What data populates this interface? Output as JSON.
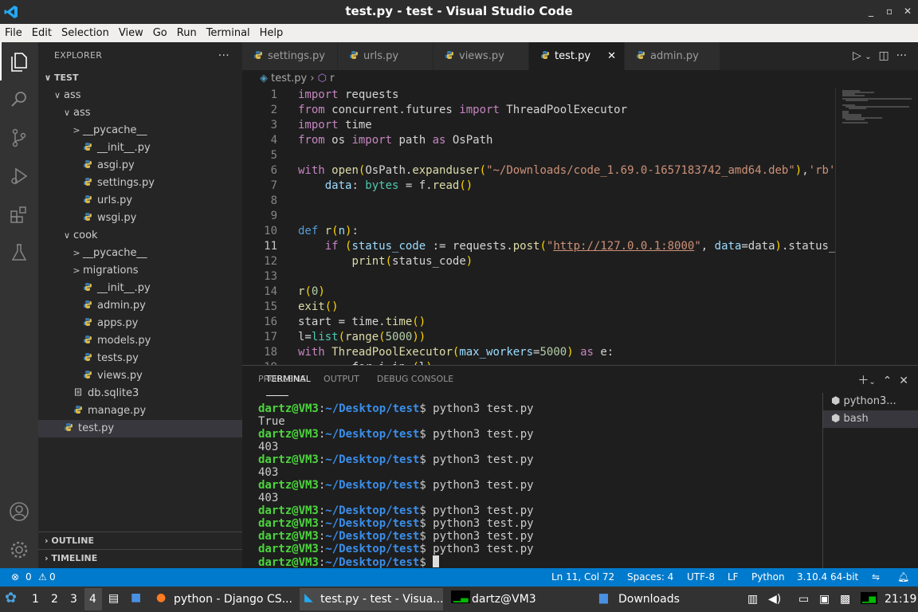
{
  "window": {
    "title": "test.py - test - Visual Studio Code",
    "controls": [
      "_",
      "▫",
      "✕"
    ]
  },
  "menu": [
    "File",
    "Edit",
    "Selection",
    "View",
    "Go",
    "Run",
    "Terminal",
    "Help"
  ],
  "sidebar": {
    "header": "EXPLORER",
    "more": "···",
    "tree": [
      {
        "label": "TEST",
        "indent": 0,
        "type": "root",
        "chev": "∨"
      },
      {
        "label": "ass",
        "indent": 1,
        "type": "folder",
        "chev": "∨"
      },
      {
        "label": "ass",
        "indent": 2,
        "type": "folder",
        "chev": "∨"
      },
      {
        "label": "__pycache__",
        "indent": 3,
        "type": "folder",
        "chev": ">"
      },
      {
        "label": "__init__.py",
        "indent": 3,
        "type": "py"
      },
      {
        "label": "asgi.py",
        "indent": 3,
        "type": "py"
      },
      {
        "label": "settings.py",
        "indent": 3,
        "type": "py"
      },
      {
        "label": "urls.py",
        "indent": 3,
        "type": "py"
      },
      {
        "label": "wsgi.py",
        "indent": 3,
        "type": "py"
      },
      {
        "label": "cook",
        "indent": 2,
        "type": "folder",
        "chev": "∨"
      },
      {
        "label": "__pycache__",
        "indent": 3,
        "type": "folder",
        "chev": ">"
      },
      {
        "label": "migrations",
        "indent": 3,
        "type": "folder",
        "chev": ">"
      },
      {
        "label": "__init__.py",
        "indent": 3,
        "type": "py"
      },
      {
        "label": "admin.py",
        "indent": 3,
        "type": "py"
      },
      {
        "label": "apps.py",
        "indent": 3,
        "type": "py"
      },
      {
        "label": "models.py",
        "indent": 3,
        "type": "py"
      },
      {
        "label": "tests.py",
        "indent": 3,
        "type": "py"
      },
      {
        "label": "views.py",
        "indent": 3,
        "type": "py"
      },
      {
        "label": "db.sqlite3",
        "indent": 2,
        "type": "db"
      },
      {
        "label": "manage.py",
        "indent": 2,
        "type": "py"
      },
      {
        "label": "test.py",
        "indent": 1,
        "type": "py",
        "selected": true
      }
    ],
    "outline": "OUTLINE",
    "timeline": "TIMELINE"
  },
  "tabs": [
    {
      "label": "settings.py",
      "active": false
    },
    {
      "label": "urls.py",
      "active": false
    },
    {
      "label": "views.py",
      "active": false
    },
    {
      "label": "test.py",
      "active": true
    },
    {
      "label": "admin.py",
      "active": false
    }
  ],
  "tab_close": "✕",
  "breadcrumb": {
    "file": "test.py",
    "sep": "›",
    "symbol": "r"
  },
  "editor": {
    "current_line": 11,
    "lines": [
      [
        [
          "k",
          "import"
        ],
        [
          "w",
          " requests"
        ]
      ],
      [
        [
          "k",
          "from"
        ],
        [
          "w",
          " concurrent.futures "
        ],
        [
          "k",
          "import"
        ],
        [
          "w",
          " ThreadPoolExecutor"
        ]
      ],
      [
        [
          "k",
          "import"
        ],
        [
          "w",
          " time"
        ]
      ],
      [
        [
          "k",
          "from"
        ],
        [
          "w",
          " os "
        ],
        [
          "k",
          "import"
        ],
        [
          "w",
          " path "
        ],
        [
          "k",
          "as"
        ],
        [
          "w",
          " OsPath"
        ]
      ],
      [],
      [
        [
          "k",
          "with"
        ],
        [
          "w",
          " "
        ],
        [
          "f",
          "open"
        ],
        [
          "p",
          "("
        ],
        [
          "w",
          "OsPath."
        ],
        [
          "f",
          "expanduser"
        ],
        [
          "p",
          "("
        ],
        [
          "s",
          "\"~/Downloads/code_1.69.0-1657183742_amd64.deb\""
        ],
        [
          "p",
          ")"
        ],
        [
          "w",
          ","
        ],
        [
          "s",
          "'rb'"
        ]
      ],
      [
        [
          "w",
          "    "
        ],
        [
          "v",
          "data"
        ],
        [
          "w",
          ": "
        ],
        [
          "t",
          "bytes"
        ],
        [
          "w",
          " = f."
        ],
        [
          "f",
          "read"
        ],
        [
          "p",
          "()"
        ]
      ],
      [],
      [],
      [
        [
          "kb",
          "def"
        ],
        [
          "w",
          " "
        ],
        [
          "f",
          "r"
        ],
        [
          "p",
          "("
        ],
        [
          "v",
          "n"
        ],
        [
          "p",
          ")"
        ],
        [
          "w",
          ":"
        ]
      ],
      [
        [
          "w",
          "    "
        ],
        [
          "k",
          "if"
        ],
        [
          "w",
          " "
        ],
        [
          "p",
          "("
        ],
        [
          "v",
          "status_code"
        ],
        [
          "w",
          " := requests."
        ],
        [
          "f",
          "post"
        ],
        [
          "p",
          "("
        ],
        [
          "s",
          "\""
        ],
        [
          "u",
          "http://127.0.0.1:8000"
        ],
        [
          "s",
          "\""
        ],
        [
          "w",
          ", "
        ],
        [
          "v",
          "data"
        ],
        [
          "w",
          "=data"
        ],
        [
          "p",
          ")"
        ],
        [
          "w",
          ".status_"
        ]
      ],
      [
        [
          "w",
          "        "
        ],
        [
          "f",
          "print"
        ],
        [
          "p",
          "("
        ],
        [
          "w",
          "status_code"
        ],
        [
          "p",
          ")"
        ]
      ],
      [],
      [
        [
          "f",
          "r"
        ],
        [
          "p",
          "("
        ],
        [
          "n",
          "0"
        ],
        [
          "p",
          ")"
        ]
      ],
      [
        [
          "f",
          "exit"
        ],
        [
          "p",
          "()"
        ]
      ],
      [
        [
          "w",
          "start = time."
        ],
        [
          "f",
          "time"
        ],
        [
          "p",
          "()"
        ]
      ],
      [
        [
          "w",
          "l="
        ],
        [
          "t",
          "list"
        ],
        [
          "p",
          "("
        ],
        [
          "f",
          "range"
        ],
        [
          "p",
          "("
        ],
        [
          "n",
          "5000"
        ],
        [
          "p",
          "))"
        ]
      ],
      [
        [
          "k",
          "with"
        ],
        [
          "w",
          " "
        ],
        [
          "f",
          "ThreadPoolExecutor"
        ],
        [
          "p",
          "("
        ],
        [
          "v",
          "max_workers"
        ],
        [
          "w",
          "="
        ],
        [
          "n",
          "5000"
        ],
        [
          "p",
          ")"
        ],
        [
          "w",
          " "
        ],
        [
          "k",
          "as"
        ],
        [
          "w",
          " e:"
        ]
      ],
      [
        [
          "w",
          "        "
        ],
        [
          "w",
          "for"
        ],
        [
          "w",
          " i "
        ],
        [
          "w",
          "in"
        ],
        [
          "w",
          " "
        ],
        [
          "p",
          "("
        ],
        [
          "w",
          "l"
        ],
        [
          "p",
          ")"
        ]
      ]
    ]
  },
  "panel": {
    "tabs": [
      "PROBLEMS",
      "OUTPUT",
      "DEBUG CONSOLE",
      "TERMINAL"
    ],
    "active": "TERMINAL",
    "terminal": [
      {
        "user": "dartz@VM3",
        "path": "~/Desktop/test",
        "cmd": "python3 test.py"
      },
      {
        "out": "True"
      },
      {
        "user": "dartz@VM3",
        "path": "~/Desktop/test",
        "cmd": "python3 test.py"
      },
      {
        "out": "403"
      },
      {
        "user": "dartz@VM3",
        "path": "~/Desktop/test",
        "cmd": "python3 test.py"
      },
      {
        "out": "403"
      },
      {
        "user": "dartz@VM3",
        "path": "~/Desktop/test",
        "cmd": "python3 test.py"
      },
      {
        "out": "403"
      },
      {
        "user": "dartz@VM3",
        "path": "~/Desktop/test",
        "cmd": "python3 test.py"
      },
      {
        "user": "dartz@VM3",
        "path": "~/Desktop/test",
        "cmd": "python3 test.py"
      },
      {
        "user": "dartz@VM3",
        "path": "~/Desktop/test",
        "cmd": "python3 test.py"
      },
      {
        "user": "dartz@VM3",
        "path": "~/Desktop/test",
        "cmd": "python3 test.py"
      },
      {
        "user": "dartz@VM3",
        "path": "~/Desktop/test",
        "cmd": "",
        "cursor": true
      }
    ],
    "term_list": [
      {
        "label": "python3...",
        "selected": false
      },
      {
        "label": "bash",
        "selected": true
      }
    ]
  },
  "status": {
    "errors": "0",
    "warnings": "0",
    "position": "Ln 11, Col 72",
    "spaces": "Spaces: 4",
    "encoding": "UTF-8",
    "eol": "LF",
    "language": "Python",
    "interpreter": "3.10.4 64-bit"
  },
  "taskbar": {
    "workspaces": [
      "1",
      "2",
      "3",
      "4"
    ],
    "active_ws": "4",
    "apps": [
      {
        "label": "python - Django CS..."
      },
      {
        "label": "test.py - test - Visua..."
      },
      {
        "label": "dartz@VM3"
      },
      {
        "label": "Downloads"
      }
    ],
    "clock": "21:19"
  },
  "colors": {
    "accent": "#007acc",
    "activity": "#333333",
    "sidebar": "#252526",
    "editor": "#1e1e1e"
  }
}
